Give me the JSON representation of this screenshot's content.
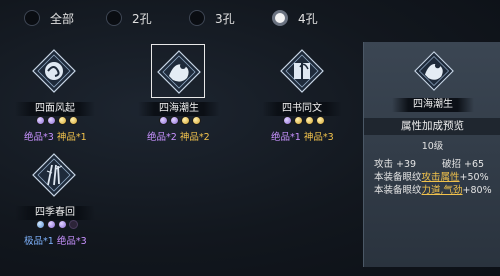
{
  "filters": [
    {
      "label": "全部",
      "selected": false
    },
    {
      "label": "2孔",
      "selected": false
    },
    {
      "label": "3孔",
      "selected": false
    },
    {
      "label": "4孔",
      "selected": true
    }
  ],
  "items": [
    {
      "name": "四面风起",
      "icon": "swirl-emblem-icon",
      "gems": [
        "p",
        "p",
        "g",
        "g"
      ],
      "counts": [
        {
          "text": "绝品*3",
          "color": "purple"
        },
        {
          "text": "神品*1",
          "color": "gold"
        }
      ]
    },
    {
      "name": "四海潮生",
      "icon": "wave-flower-emblem-icon",
      "selected": true,
      "gems": [
        "p",
        "p",
        "g",
        "g"
      ],
      "counts": [
        {
          "text": "绝品*2",
          "color": "purple"
        },
        {
          "text": "神品*2",
          "color": "gold"
        }
      ]
    },
    {
      "name": "四书同文",
      "icon": "book-emblem-icon",
      "gems": [
        "p",
        "g",
        "g",
        "g"
      ],
      "counts": [
        {
          "text": "绝品*1",
          "color": "purple"
        },
        {
          "text": "神品*3",
          "color": "gold"
        }
      ]
    },
    {
      "name": "四季春回",
      "icon": "bamboo-emblem-icon",
      "gems": [
        "b",
        "p",
        "p",
        "d"
      ],
      "counts": [
        {
          "text": "极品*1",
          "color": "blue"
        },
        {
          "text": "绝品*3",
          "color": "purple"
        }
      ]
    }
  ],
  "detail": {
    "name": "四海潮生",
    "section_title": "属性加成预览",
    "level": "10级",
    "stats": [
      {
        "label": "攻击",
        "value": "+39"
      },
      {
        "label": "破招",
        "value": "+65"
      }
    ],
    "bonus_lines": [
      {
        "prefix": "本装备眼纹",
        "attr": "攻击属性",
        "value": "+50%"
      },
      {
        "prefix": "本装备眼纹",
        "attr": "力道,气劲",
        "value": "+80%"
      }
    ]
  }
}
